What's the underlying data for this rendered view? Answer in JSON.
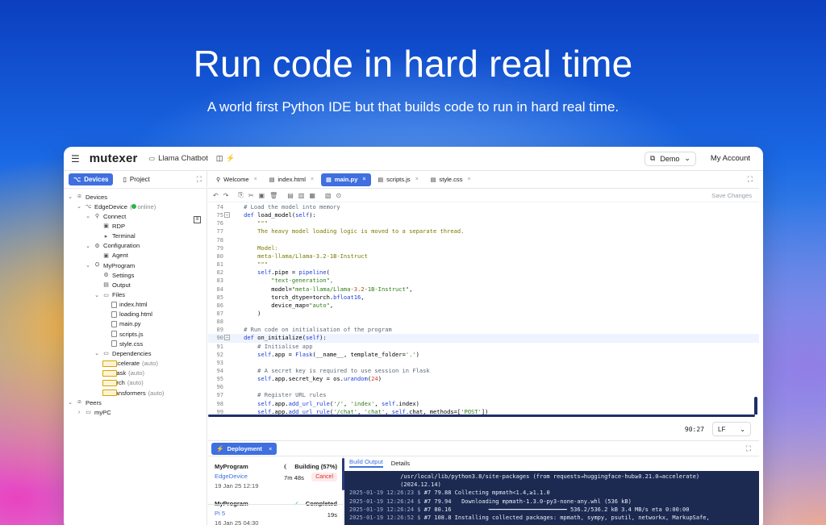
{
  "hero": {
    "title": "Run code in hard real time",
    "subtitle": "A world first Python IDE but that builds code to run in hard real time."
  },
  "topbar": {
    "brand": "mutexer",
    "project": "Llama Chatbot",
    "demo": "Demo",
    "account": "My Account"
  },
  "left": {
    "tabs": [
      "Devices",
      "Project"
    ],
    "tree": [
      {
        "label": "Devices",
        "icon": "devices-icon",
        "depth": 0,
        "chev": "v"
      },
      {
        "label": "EdgeDevice",
        "icon": "device-icon",
        "depth": 1,
        "chev": "v",
        "status": "online"
      },
      {
        "label": "Connect",
        "icon": "link-icon",
        "depth": 2,
        "chev": "v"
      },
      {
        "label": "RDP",
        "icon": "screen-icon",
        "depth": 3
      },
      {
        "label": "Terminal",
        "icon": "terminal-icon",
        "depth": 3
      },
      {
        "label": "Configuration",
        "icon": "gear-icon",
        "depth": 2,
        "chev": "v"
      },
      {
        "label": "Agent",
        "icon": "agent-icon",
        "depth": 3
      },
      {
        "label": "MyProgram",
        "icon": "program-icon",
        "depth": 2,
        "chev": "v"
      },
      {
        "label": "Settings",
        "icon": "gear-icon",
        "depth": 3
      },
      {
        "label": "Output",
        "icon": "output-icon",
        "depth": 3
      },
      {
        "label": "Files",
        "icon": "folder-icon",
        "depth": 3,
        "chev": "v"
      },
      {
        "label": "index.html",
        "icon": "file-icon",
        "depth": 4
      },
      {
        "label": "loading.html",
        "icon": "file-icon",
        "depth": 4
      },
      {
        "label": "main.py",
        "icon": "file-icon",
        "depth": 4
      },
      {
        "label": "scripts.js",
        "icon": "file-icon",
        "depth": 4
      },
      {
        "label": "style.css",
        "icon": "file-icon",
        "depth": 4
      },
      {
        "label": "Dependencies",
        "icon": "folder-icon",
        "depth": 3,
        "chev": "v"
      },
      {
        "label": "accelerate",
        "suffix": "(auto)",
        "icon": "package-icon",
        "depth": 4
      },
      {
        "label": "Flask",
        "suffix": "(auto)",
        "icon": "package-icon",
        "depth": 4
      },
      {
        "label": "torch",
        "suffix": "(auto)",
        "icon": "package-icon",
        "depth": 4
      },
      {
        "label": "transformers",
        "suffix": "(auto)",
        "icon": "package-icon",
        "depth": 4
      },
      {
        "label": "Peers",
        "icon": "peers-icon",
        "depth": 0,
        "chev": "v"
      },
      {
        "label": "myPC",
        "icon": "pc-icon",
        "depth": 1,
        "chev": ">"
      }
    ]
  },
  "editor": {
    "tabs": [
      {
        "label": "Welcome",
        "icon": "rocket-icon",
        "active": false
      },
      {
        "label": "index.html",
        "icon": "file-icon",
        "active": false
      },
      {
        "label": "main.py",
        "icon": "file-icon",
        "active": true
      },
      {
        "label": "scripts.js",
        "icon": "file-icon",
        "active": false
      },
      {
        "label": "style.css",
        "icon": "file-icon",
        "active": false
      }
    ],
    "save_label": "Save Changes",
    "lines": [
      {
        "n": "74",
        "t": "    # Load the model into memory",
        "cls": "c"
      },
      {
        "n": "75",
        "t": "    def load_model(self):",
        "cls": "def",
        "fold": true
      },
      {
        "n": "76",
        "t": "        \"\"\"",
        "cls": "st"
      },
      {
        "n": "77",
        "t": "        The heavy model loading logic is moved to a separate thread.",
        "cls": "st"
      },
      {
        "n": "78",
        "t": "",
        "cls": "p"
      },
      {
        "n": "79",
        "t": "        Model:",
        "cls": "st"
      },
      {
        "n": "80",
        "t": "        meta-llama/Llama-3.2-1B-Instruct",
        "cls": "st"
      },
      {
        "n": "81",
        "t": "        \"\"\"",
        "cls": "st"
      },
      {
        "n": "82",
        "t": "        self.pipe = pipeline(",
        "cls": "p"
      },
      {
        "n": "83",
        "t": "            \"text-generation\",",
        "cls": "s"
      },
      {
        "n": "84",
        "t": "            model=\"meta-llama/Llama-3.2-1B-Instruct\",",
        "cls": "p"
      },
      {
        "n": "85",
        "t": "            torch_dtype=torch.bfloat16,",
        "cls": "p"
      },
      {
        "n": "86",
        "t": "            device_map=\"auto\",",
        "cls": "p"
      },
      {
        "n": "87",
        "t": "        )",
        "cls": "p"
      },
      {
        "n": "88",
        "t": "",
        "cls": "p"
      },
      {
        "n": "89",
        "t": "    # Run code on initialisation of the program",
        "cls": "c"
      },
      {
        "n": "90",
        "t": "    def on_initialize(self):",
        "cls": "def",
        "fold": true,
        "cur": true
      },
      {
        "n": "91",
        "t": "        # Initialise app",
        "cls": "c"
      },
      {
        "n": "92",
        "t": "        self.app = Flask(__name__, template_folder='.')",
        "cls": "p"
      },
      {
        "n": "93",
        "t": "",
        "cls": "p"
      },
      {
        "n": "94",
        "t": "        # A secret key is required to use session in Flask",
        "cls": "c"
      },
      {
        "n": "95",
        "t": "        self.app.secret_key = os.urandom(24)",
        "cls": "p"
      },
      {
        "n": "96",
        "t": "",
        "cls": "p"
      },
      {
        "n": "97",
        "t": "        # Register URL rules",
        "cls": "c"
      },
      {
        "n": "98",
        "t": "        self.app.add_url_rule('/', 'index', self.index)",
        "cls": "p"
      },
      {
        "n": "99",
        "t": "        self.app.add_url_rule('/chat', 'chat', self.chat, methods=['POST'])",
        "cls": "p"
      }
    ],
    "cursor_pos": "90:27",
    "line_ending": "LF"
  },
  "deployment": {
    "tab_label": "Deployment",
    "items": [
      {
        "name": "MyProgram",
        "device": "EdgeDevice",
        "date": "19 Jan 25 12:19",
        "status": "Building (57%)",
        "duration": "7m 48s",
        "cancel": "Cancel"
      },
      {
        "name": "MyProgram",
        "device": "Pi 5",
        "date": "16 Jan 25 04:30",
        "status": "Completed",
        "duration": "19s"
      }
    ],
    "output_tabs": [
      "Build Output",
      "Details"
    ],
    "terminal": [
      {
        "ts": "",
        "text": "               /usr/local/lib/python3.8/site-packages (from requests→huggingface-hub≥0.21.0→accelerate)"
      },
      {
        "ts": "",
        "text": "               (2024.12.14)"
      },
      {
        "ts": "2025-01-19 12:26:23 $",
        "text": " #7 79.88 Collecting mpmath<1.4,≥1.1.0"
      },
      {
        "ts": "2025-01-19 12:26:24 $",
        "text": " #7 79.94   Downloading mpmath-1.3.0-py3-none-any.whl (536 kB)"
      },
      {
        "ts": "2025-01-19 12:26:24 $",
        "text": " #7 80.16           ━━━━━━━━━━━━━━━━━━━━━━━ 536.2/536.2 kB 3.4 MB/s eta 0:00:00"
      },
      {
        "ts": "2025-01-19 12:26:52 $",
        "text": " #7 108.8 Installing collected packages: mpmath, sympy, psutil, networkx, MarkupSafe,"
      }
    ]
  }
}
